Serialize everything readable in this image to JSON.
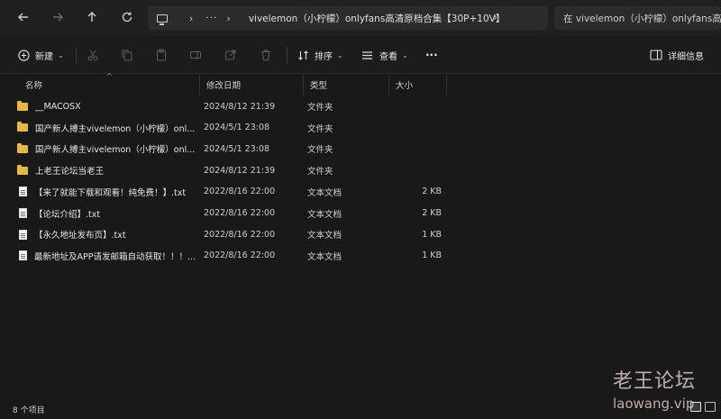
{
  "address_bar": {
    "path": "vivelemon（小柠檬）onlyfans高清原档合集【30P+10V】",
    "dots": "···",
    "search_placeholder": "在 vivelemon（小柠檬）onlyfans高"
  },
  "toolbar": {
    "new_label": "新建",
    "sort_label": "排序",
    "view_label": "查看",
    "more_label": "···",
    "details_label": "详细信息"
  },
  "columns": {
    "name": "名称",
    "date": "修改日期",
    "type": "类型",
    "size": "大小"
  },
  "files": [
    {
      "name": "__MACOSX",
      "date": "2024/8/12 21:39",
      "type": "文件夹",
      "size": "",
      "kind": "folder"
    },
    {
      "name": "国产新人搏主vivelemon（小柠檬）onl...",
      "date": "2024/5/1 23:08",
      "type": "文件夹",
      "size": "",
      "kind": "folder"
    },
    {
      "name": "国产新人搏主vivelemon（小柠檬）onl...",
      "date": "2024/5/1 23:08",
      "type": "文件夹",
      "size": "",
      "kind": "folder"
    },
    {
      "name": "上老王论坛当老王",
      "date": "2024/8/12 21:39",
      "type": "文件夹",
      "size": "",
      "kind": "folder"
    },
    {
      "name": "【来了就能下载和观看！纯免费！】.txt",
      "date": "2022/8/16 22:00",
      "type": "文本文档",
      "size": "2 KB",
      "kind": "doc"
    },
    {
      "name": "【论坛介绍】.txt",
      "date": "2022/8/16 22:00",
      "type": "文本文档",
      "size": "2 KB",
      "kind": "doc"
    },
    {
      "name": "【永久地址发布页】.txt",
      "date": "2022/8/16 22:00",
      "type": "文本文档",
      "size": "1 KB",
      "kind": "doc"
    },
    {
      "name": "最新地址及APP请发邮箱自动获取！！！...",
      "date": "2022/8/16 22:00",
      "type": "文本文档",
      "size": "1 KB",
      "kind": "doc"
    }
  ],
  "status": {
    "item_count": "8 个项目"
  },
  "watermark": {
    "title": "老王论坛",
    "url": "laowang.vip"
  },
  "colors": {
    "background": "#191919",
    "folder": "#e8b93d",
    "watermark": "#dcc8c8"
  }
}
